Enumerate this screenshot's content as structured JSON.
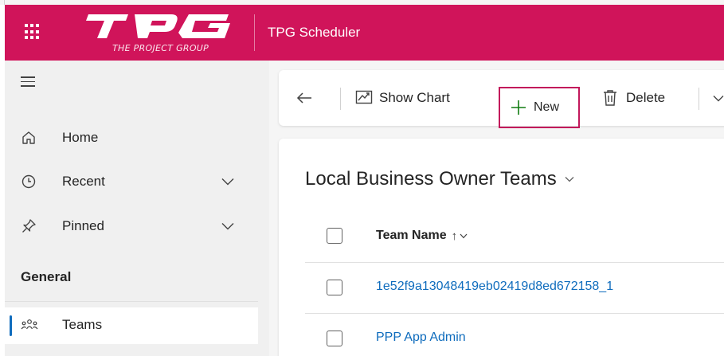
{
  "header": {
    "logo_text": "TPG",
    "logo_subtitle": "THE PROJECT GROUP",
    "app_title": "TPG Scheduler",
    "accent_color": "#d0145a"
  },
  "nav": {
    "items": [
      {
        "label": "Home",
        "icon": "home-icon"
      },
      {
        "label": "Recent",
        "icon": "clock-icon"
      },
      {
        "label": "Pinned",
        "icon": "pin-icon"
      }
    ],
    "section_title": "General",
    "selected_item": {
      "label": "Teams",
      "icon": "people-team-icon"
    }
  },
  "commands": {
    "show_chart": "Show Chart",
    "new": "New",
    "delete": "Delete"
  },
  "view": {
    "title": "Local Business Owner Teams",
    "column_header": "Team Name",
    "sort_indicator": "↑",
    "rows": [
      {
        "team_name": "1e52f9a13048419eb02419d8ed672158_1"
      },
      {
        "team_name": "PPP App Admin"
      }
    ]
  }
}
